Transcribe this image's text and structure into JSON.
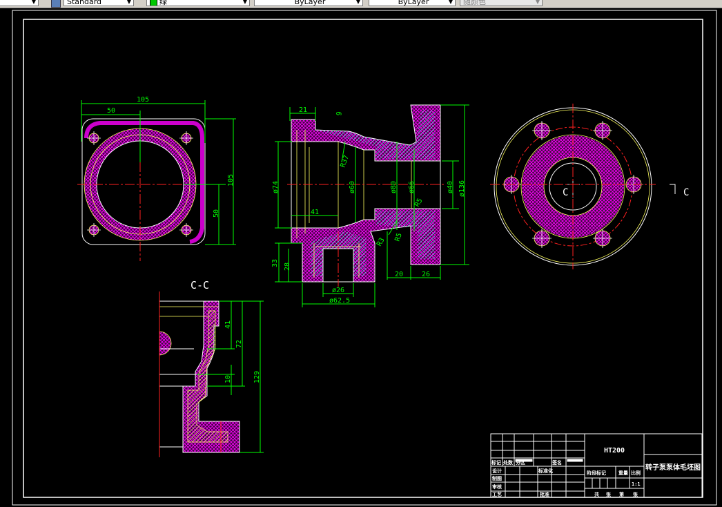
{
  "toolbar": {
    "first_combo_value": "",
    "text_style": "Standard",
    "color": "绿",
    "color_hex": "#00c800",
    "linetype": "ByLayer",
    "lineweight": "ByLayer",
    "plot_style": "随颜色"
  },
  "drawing": {
    "front_view": {
      "dim_width": "105",
      "dim_half_width": "50",
      "dim_height": "105",
      "dim_half_height": "50"
    },
    "section_view": {
      "d21": "21",
      "d9": "9",
      "r37": "R37",
      "phi74": "ø74",
      "d41": "41",
      "phi60": "ø60",
      "phi80": "ø80",
      "phi66": "ø66",
      "phi40": "ø40",
      "phi136": "ø136",
      "r5a": "R5",
      "r3": "R3",
      "r5b": "R5",
      "d33": "33",
      "d28": "28",
      "d20": "20",
      "d26": "26",
      "phi26": "ø26",
      "phi62_5": "ø62.5"
    },
    "cc_view": {
      "title": "C-C",
      "d41": "41",
      "d72": "72",
      "d10": "10",
      "d129": "129"
    },
    "side_view": {
      "section_label_left": "C",
      "section_label_right": "C"
    },
    "colors": {
      "outline": "#ffffff",
      "dimension": "#00ff00",
      "centerline": "#ff0000",
      "hatch": "#ff00ff",
      "hidden": "#ffff00",
      "hatch_alt": "#00ffff"
    }
  },
  "title_block": {
    "material": "HT200",
    "drawing_name": "转子泵泵体毛坯图",
    "mark": "标记",
    "count": "处数",
    "zone": "分区",
    "signature": "签名",
    "design": "设计",
    "standardization": "标准化",
    "drafting": "制图",
    "review": "审核",
    "process": "工艺",
    "approve": "批准",
    "stage_mark": "阶段标记",
    "weight": "重量",
    "scale_label": "比例",
    "scale": "1:1",
    "sheets_total": "共",
    "sheet_unit_1": "张",
    "sheet_no": "第",
    "sheet_unit_2": "张"
  }
}
